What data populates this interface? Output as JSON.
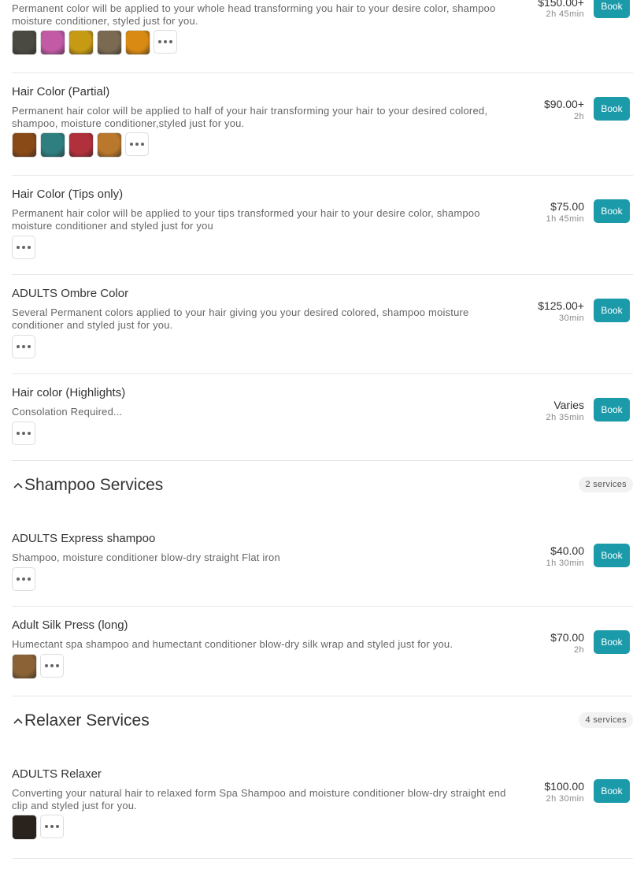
{
  "book_label": "Book",
  "more_icon": "more-horizontal-icon",
  "services_top": [
    {
      "name": "",
      "description": "Permanent color will be applied to your whole head transforming you hair to your desire color, shampoo moisture conditioner, styled just for you.",
      "price": "$150.00+",
      "duration": "2h 45min",
      "thumb_colors": [
        "#4a4a42",
        "#c25aa6",
        "#c79a14",
        "#7a6a52",
        "#d88a12"
      ]
    },
    {
      "name": "Hair Color (Partial)",
      "description": "Permanent hair color will be applied to half of your hair transforming your hair to your desired colored, shampoo, moisture conditioner,styled just for you.",
      "price": "$90.00+",
      "duration": "2h",
      "thumb_colors": [
        "#8a4a18",
        "#2f7f80",
        "#b0303c",
        "#b9782c"
      ]
    },
    {
      "name": "Hair Color (Tips only)",
      "description": "Permanent hair color will be applied to your tips transformed your hair to your desire color, shampoo moisture conditioner and styled just for you",
      "price": "$75.00",
      "duration": "1h 45min",
      "thumb_colors": []
    },
    {
      "name": "ADULTS Ombre Color",
      "description": "Several Permanent colors applied to your hair giving you your desired colored, shampoo moisture conditioner and styled just for you.",
      "price": "$125.00+",
      "duration": "30min",
      "thumb_colors": []
    },
    {
      "name": "Hair color (Highlights)",
      "description": "Consolation Required...",
      "price": "Varies",
      "duration": "2h 35min",
      "thumb_colors": []
    }
  ],
  "shampoo": {
    "title": "Shampoo Services",
    "count": "2 services",
    "services": [
      {
        "name": "ADULTS Express shampoo",
        "description": "Shampoo, moisture conditioner blow-dry straight Flat iron",
        "price": "$40.00",
        "duration": "1h 30min",
        "thumb_colors": []
      },
      {
        "name": "Adult Silk Press (long)",
        "description": "Humectant spa shampoo and humectant conditioner blow-dry silk wrap and styled just for you.",
        "price": "$70.00",
        "duration": "2h",
        "thumb_colors": [
          "#8a6236"
        ]
      }
    ]
  },
  "relaxer": {
    "title": "Relaxer Services",
    "count": "4 services",
    "services": [
      {
        "name": "ADULTS Relaxer",
        "description": "Converting your natural hair to relaxed form Spa Shampoo and moisture conditioner blow-dry straight end clip and styled just for you.",
        "price": "$100.00",
        "duration": "2h 30min",
        "thumb_colors": [
          "#2a221c"
        ]
      }
    ]
  }
}
